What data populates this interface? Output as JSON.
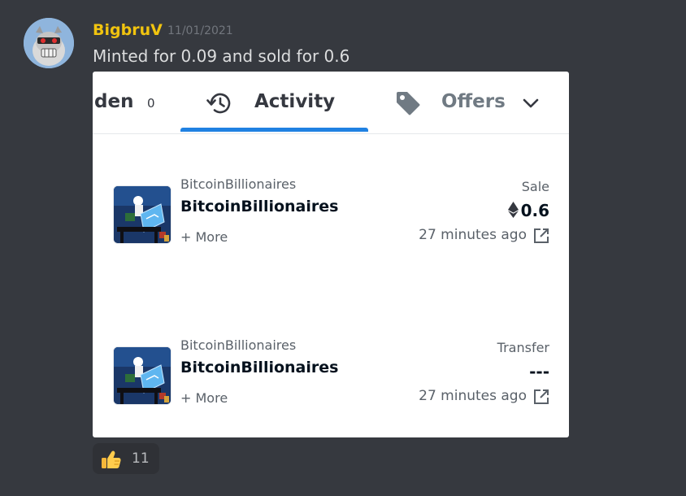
{
  "message": {
    "username": "BigbruV",
    "timestamp": "11/01/2021",
    "content": "Minted for 0.09 and sold for 0.6",
    "avatar_icon": "robot-bulldog-avatar"
  },
  "embed": {
    "tabs": [
      {
        "label": "den",
        "count": "0"
      },
      {
        "label": "Activity",
        "icon": "history-icon",
        "active": true
      },
      {
        "label": "Offers",
        "icon": "tag-icon"
      }
    ],
    "accent_color": "#2081e2",
    "rows": [
      {
        "collection": "BitcoinBillionaires",
        "name": "BitcoinBillionaires",
        "more": "+ More",
        "event": "Sale",
        "price": "0.6",
        "time": "27 minutes ago"
      },
      {
        "collection": "BitcoinBillionaires",
        "name": "BitcoinBillionaires",
        "more": "+ More",
        "event": "Transfer",
        "price": "---",
        "time": "27 minutes ago"
      }
    ]
  },
  "reaction": {
    "emoji": "thumbs-up",
    "count": "11"
  },
  "colors": {
    "background": "#36393f",
    "username": "#f1c40f"
  }
}
